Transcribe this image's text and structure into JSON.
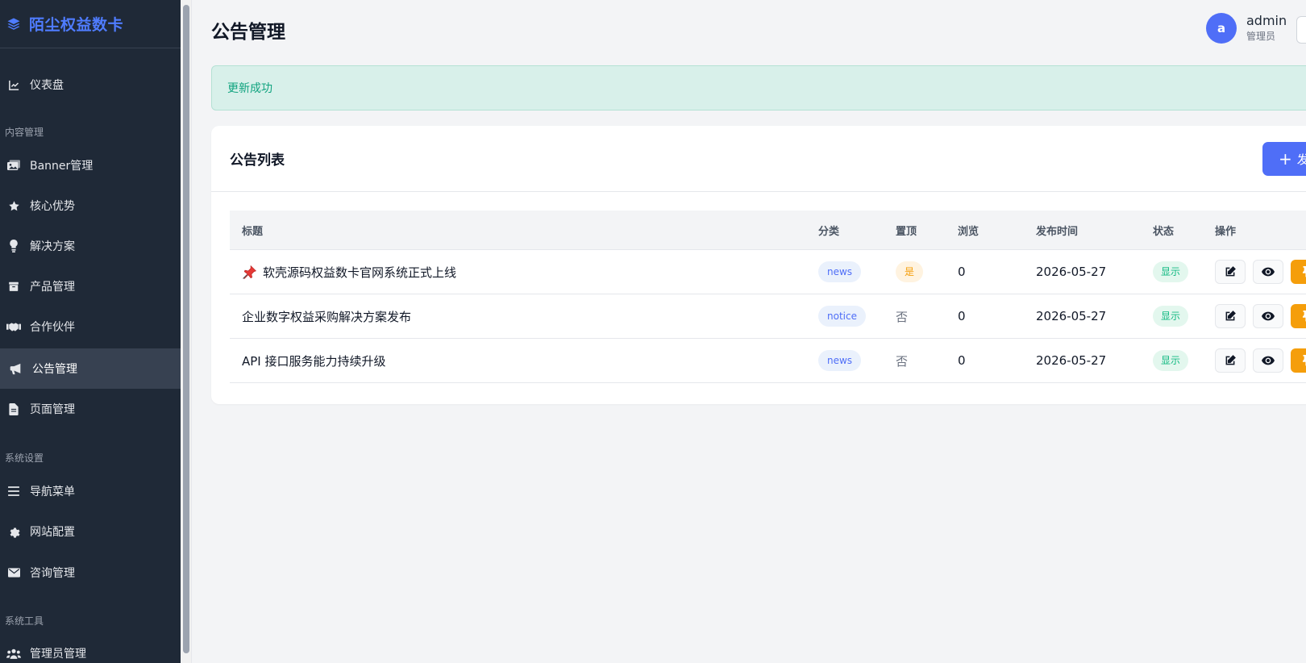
{
  "brand": {
    "name": "陌尘权益数卡"
  },
  "sidebar": {
    "groups": {
      "content": "内容管理",
      "system": "系统设置",
      "tools": "系统工具"
    },
    "items": [
      {
        "label": "仪表盘",
        "icon": "chart-line-icon"
      },
      {
        "label": "Banner管理",
        "icon": "images-icon"
      },
      {
        "label": "核心优势",
        "icon": "star-icon"
      },
      {
        "label": "解决方案",
        "icon": "lightbulb-icon"
      },
      {
        "label": "产品管理",
        "icon": "box-icon"
      },
      {
        "label": "合作伙伴",
        "icon": "handshake-icon"
      },
      {
        "label": "公告管理",
        "icon": "bullhorn-icon",
        "active": true
      },
      {
        "label": "页面管理",
        "icon": "file-icon"
      },
      {
        "label": "导航菜单",
        "icon": "menu-icon"
      },
      {
        "label": "网站配置",
        "icon": "gear-icon"
      },
      {
        "label": "咨询管理",
        "icon": "envelope-icon"
      },
      {
        "label": "管理员管理",
        "icon": "users-icon"
      }
    ]
  },
  "header": {
    "title": "公告管理",
    "user": {
      "avatar_letter": "a",
      "name": "admin",
      "role": "管理员"
    }
  },
  "alert": {
    "text": "更新成功"
  },
  "card": {
    "title": "公告列表",
    "add_button": "发"
  },
  "table": {
    "columns": [
      "标题",
      "分类",
      "置顶",
      "浏览",
      "发布时间",
      "状态",
      "操作"
    ],
    "rows": [
      {
        "title": "软壳源码权益数卡官网系统正式上线",
        "pinned": true,
        "category": "news",
        "top": "是",
        "views": "0",
        "date": "2026-05-27",
        "status": "显示"
      },
      {
        "title": "企业数字权益采购解决方案发布",
        "pinned": false,
        "category": "notice",
        "top": "否",
        "views": "0",
        "date": "2026-05-27",
        "status": "显示"
      },
      {
        "title": "API 接口服务能力持续升级",
        "pinned": false,
        "category": "news",
        "top": "否",
        "views": "0",
        "date": "2026-05-27",
        "status": "显示"
      }
    ]
  },
  "colors": {
    "accent": "#4f6ef7",
    "sidebar_bg": "#1f2937",
    "success": "#10b981",
    "warning": "#f59e0b"
  }
}
